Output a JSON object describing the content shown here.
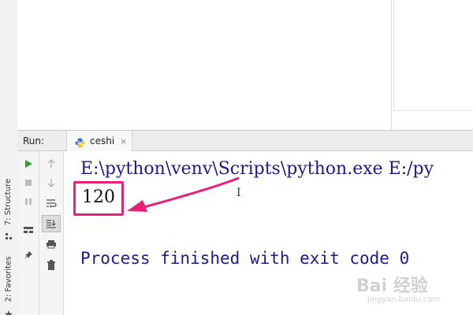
{
  "left_strip": {
    "structure_tab": "7: Structure",
    "favorites_tab": "2: Favorites"
  },
  "run_panel": {
    "label": "Run:",
    "tab": {
      "name": "ceshi",
      "icon": "python-icon",
      "close_glyph": "×"
    }
  },
  "toolbar_left": {
    "buttons": [
      "play-icon",
      "stop-icon",
      "pause-icon",
      "layout-icon",
      "pin-icon"
    ]
  },
  "toolbar_right": {
    "buttons": [
      "up-arrow-icon",
      "down-arrow-icon",
      "soft-wrap-icon",
      "scroll-to-end-icon",
      "print-icon",
      "trash-icon"
    ]
  },
  "console": {
    "command_line": "E:\\python\\venv\\Scripts\\python.exe E:/py",
    "result": "120",
    "cursor_glyph": "I",
    "exit_message": "Process finished with exit code 0"
  },
  "watermark": {
    "main": "Bai 经验",
    "sub": "jingyan.baidu.com"
  },
  "colors": {
    "console_text": "#1c1c8c",
    "highlight": "#e8207a",
    "run_green": "#3c9a3c"
  }
}
